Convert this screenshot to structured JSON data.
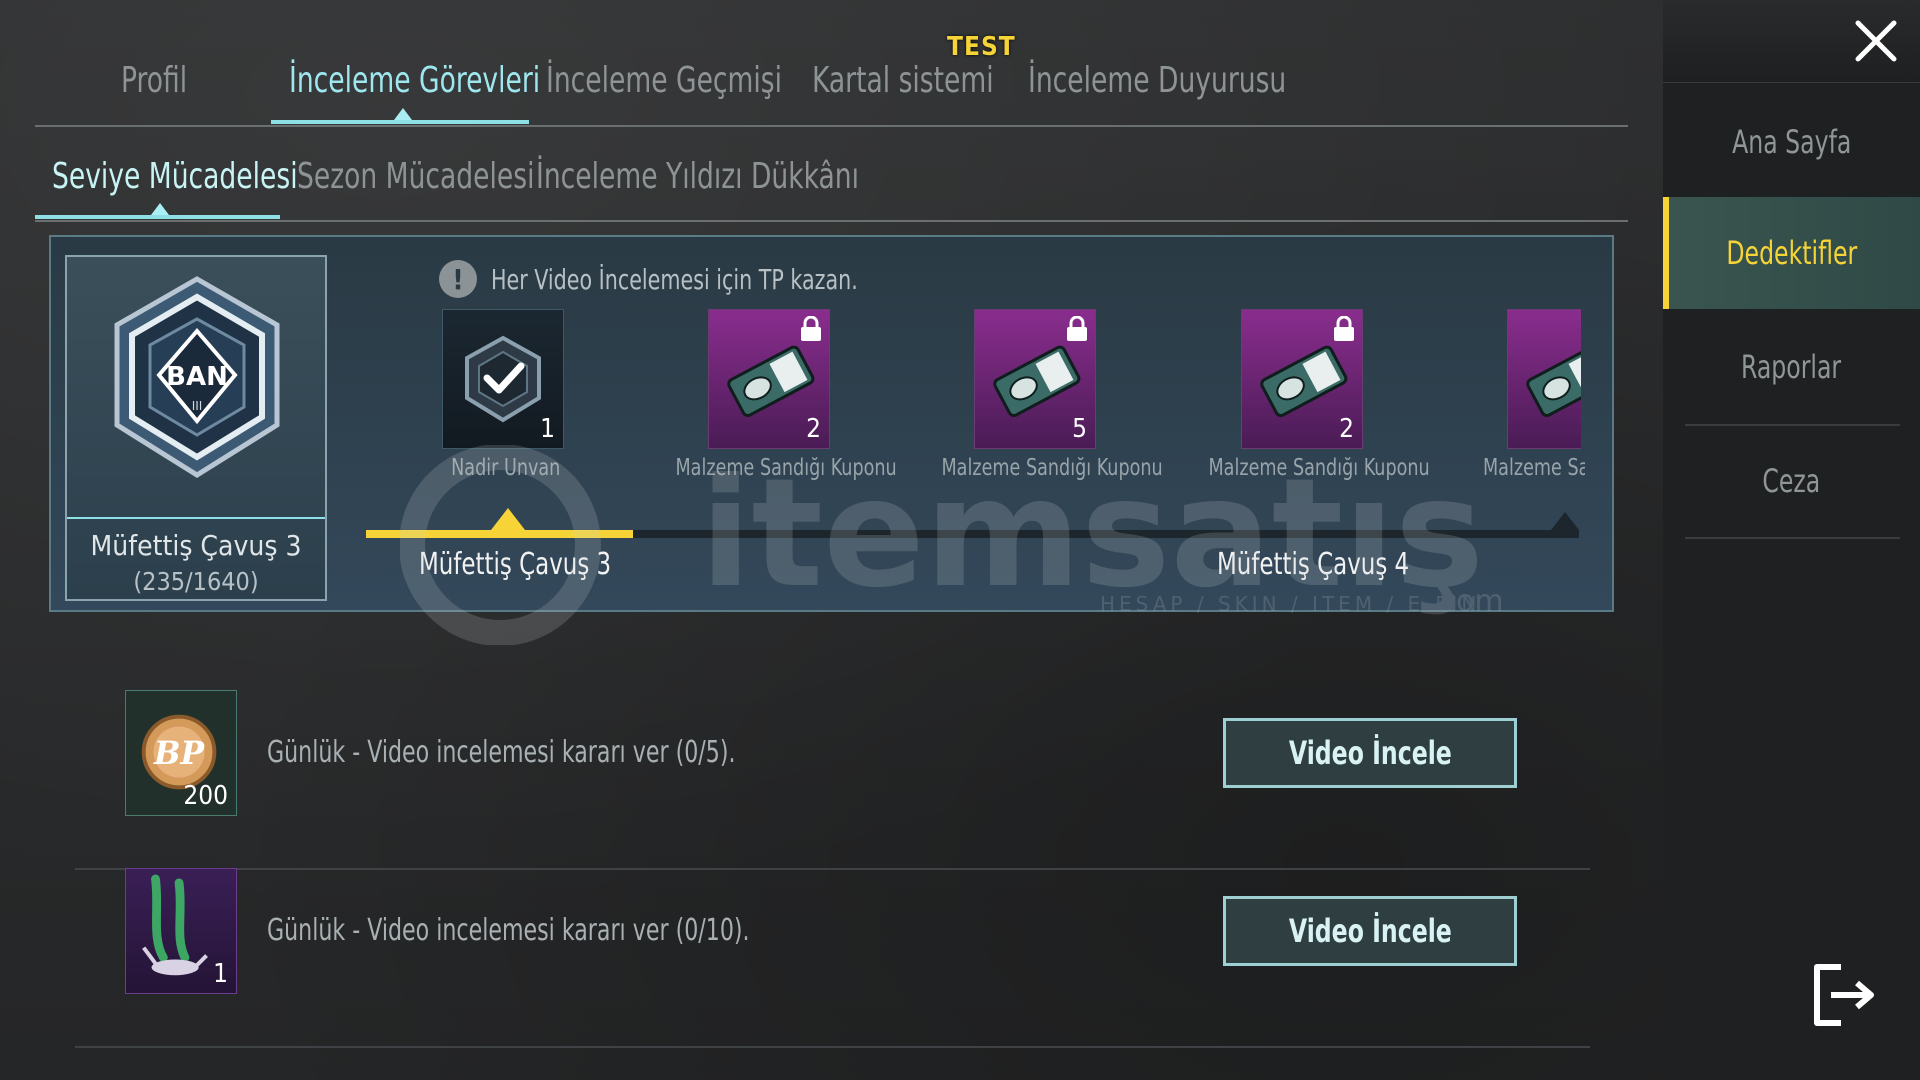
{
  "top_tabs": [
    {
      "label": "Profil"
    },
    {
      "label": "İnceleme Görevleri"
    },
    {
      "label": "İnceleme Geçmişi"
    },
    {
      "label": "Kartal sistemi"
    },
    {
      "label": "İnceleme Duyurusu"
    }
  ],
  "test_badge": "TEST",
  "sub_tabs": [
    {
      "label": "Seviye Mücadelesi"
    },
    {
      "label": "Sezon Mücadelesi"
    },
    {
      "label": "İnceleme Yıldızı Dükkânı"
    }
  ],
  "rank": {
    "emblem_text": "BAN",
    "emblem_tier": "III",
    "name": "Müfettiş Çavuş 3",
    "progress": "(235/1640)"
  },
  "hint": {
    "icon": "!",
    "text": "Her Video İncelemesi için TP kazan."
  },
  "rewards": [
    {
      "label": "Nadir Unvan",
      "count": "1",
      "locked": false,
      "icon": "badge-check-icon"
    },
    {
      "label": "Malzeme Sandığı Kuponu",
      "count": "2",
      "locked": true,
      "icon": "coupon-icon"
    },
    {
      "label": "Malzeme Sandığı Kuponu",
      "count": "5",
      "locked": true,
      "icon": "coupon-icon"
    },
    {
      "label": "Malzeme Sandığı Kuponu",
      "count": "2",
      "locked": true,
      "icon": "coupon-icon"
    },
    {
      "label": "Malzeme Sand",
      "count": "",
      "locked": false,
      "icon": "coupon-icon"
    }
  ],
  "progress": {
    "fill_fraction": 0.22,
    "current_level": "Müfettiş Çavuş 3",
    "next_level": "Müfettiş Çavuş 4"
  },
  "watermark": {
    "brand": "itemsatış",
    "tagline": "HESAP / SKIN / ITEM / E-PIN",
    "suffix": ".com"
  },
  "tasks": [
    {
      "icon": "bp-coin-icon",
      "icon_text": "BP",
      "count": "200",
      "text": "Günlük - Video incelemesi kararı ver (0/5).",
      "button": "Video İncele"
    },
    {
      "icon": "parachute-trail-icon",
      "count": "1",
      "text": "Günlük - Video incelemesi kararı ver (0/10).",
      "button": "Video İncele"
    }
  ],
  "sidebar": {
    "items": [
      {
        "label": "Ana Sayfa",
        "active": false
      },
      {
        "label": "Dedektifler",
        "active": true
      },
      {
        "label": "Raporlar",
        "active": false
      },
      {
        "label": "Ceza",
        "active": false
      }
    ]
  },
  "colors": {
    "accent_yellow": "#f6d437",
    "accent_cyan": "#8fdfe6",
    "reward_purple": "#8a2d8e"
  }
}
